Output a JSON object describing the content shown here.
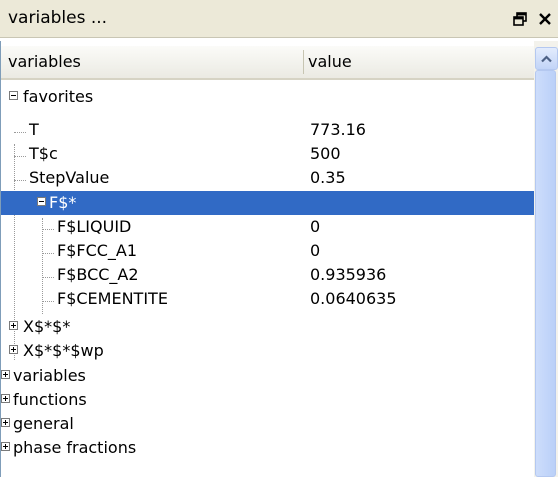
{
  "window": {
    "title": "variables ..."
  },
  "columns": {
    "name": "variables",
    "value": "value"
  },
  "tree": {
    "favorites": {
      "label": "favorites"
    },
    "items": [
      {
        "label": "T",
        "value": "773.16"
      },
      {
        "label": "T$c",
        "value": "500"
      },
      {
        "label": "StepValue",
        "value": "0.35"
      }
    ],
    "group": {
      "label": "F$*",
      "value": ""
    },
    "children": [
      {
        "label": "F$LIQUID",
        "value": "0"
      },
      {
        "label": "F$FCC_A1",
        "value": "0"
      },
      {
        "label": "F$BCC_A2",
        "value": "0.935936"
      },
      {
        "label": "F$CEMENTITE",
        "value": "0.0640635"
      }
    ],
    "collapsed_sub": [
      {
        "label": "X$*$*"
      },
      {
        "label": "X$*$*$wp"
      }
    ],
    "root_collapsed": [
      {
        "label": "variables"
      },
      {
        "label": "functions"
      },
      {
        "label": "general"
      },
      {
        "label": "phase fractions"
      }
    ]
  },
  "colors": {
    "selection": "#316ac5",
    "titlebar": "#ece9d8",
    "scrollbar_thumb": "#bad0f8"
  },
  "icons": {
    "restore": "restore-icon",
    "close": "close-icon",
    "scroll_up": "chevron-up-icon"
  }
}
